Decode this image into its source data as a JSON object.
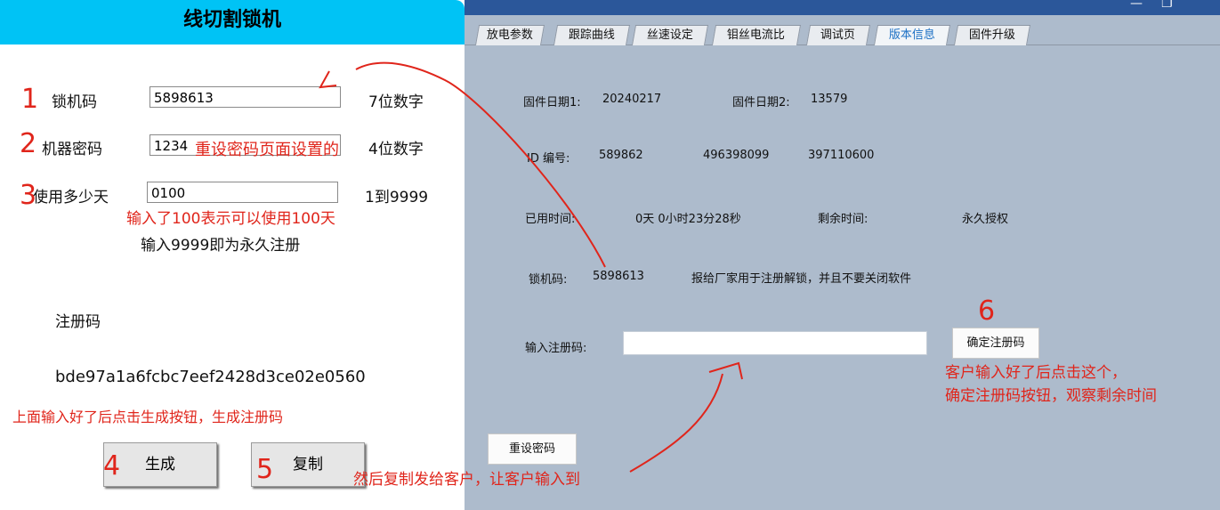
{
  "left_window": {
    "title": "线切割锁机",
    "lock_code_label": "锁机码",
    "lock_code_value": "5898613",
    "lock_code_hint": "7位数字",
    "machine_pwd_label": "机器密码",
    "machine_pwd_value": "1234",
    "machine_pwd_hint": "4位数字",
    "days_label": "使用多少天",
    "days_value": "0100",
    "days_hint": "1到9999",
    "permanent_note": "输入9999即为永久注册",
    "reg_code_label": "注册码",
    "reg_code_value": "bde97a1a6fcbc7eef2428d3ce02e0560",
    "generate_button": "生成",
    "copy_button": "复制"
  },
  "right_window": {
    "tabs": [
      "放电参数",
      "跟踪曲线",
      "丝速设定",
      "钼丝电流比",
      "调试页",
      "版本信息",
      "固件升级"
    ],
    "active_tab": "版本信息",
    "firmware_date1_label": "固件日期1:",
    "firmware_date1_value": "20240217",
    "firmware_date2_label": "固件日期2:",
    "firmware_date2_value": "13579",
    "id_label": "ID 编号:",
    "id_values": [
      "589862",
      "496398099",
      "397110600"
    ],
    "used_time_label": "已用时间:",
    "used_time_value": "0天  0小时23分28秒",
    "remaining_label": "剩余时间:",
    "remaining_value": "永久授权",
    "lock_code_label": "锁机码:",
    "lock_code_value": "5898613",
    "lock_code_note": "报给厂家用于注册解锁，并且不要关闭软件",
    "reg_input_label": "输入注册码:",
    "reg_input_value": "",
    "confirm_button": "确定注册码",
    "reset_button": "重设密码",
    "window_controls": {
      "minimize": "—",
      "maximize": "❐"
    }
  },
  "annotations": {
    "n1": "1",
    "n2": "2",
    "n3": "3",
    "n4": "4",
    "n5": "5",
    "n6": "6",
    "pwd_note": "重设密码页面设置的",
    "days_note": "输入了100表示可以使用100天",
    "generate_note": "上面输入好了后点击生成按钮，生成注册码",
    "copy_note": "然后复制发给客户，让客户输入到",
    "confirm_note_line1": "客户输入好了后点击这个，",
    "confirm_note_line2": "确定注册码按钮，观察剩余时间"
  },
  "colors": {
    "title_bar": "#00c3f5",
    "right_bg": "#adbbcc",
    "right_titlebar": "#2b579a",
    "annotation": "#e0251b"
  }
}
